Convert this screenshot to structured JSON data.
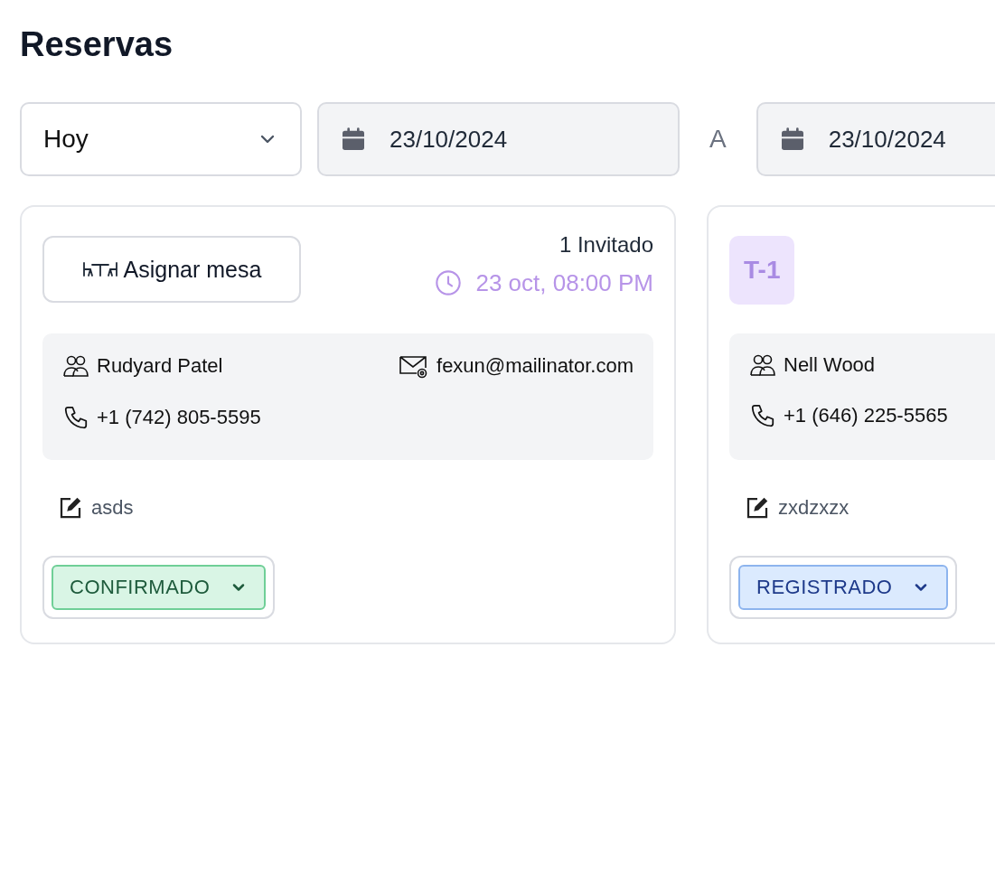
{
  "title": "Reservas",
  "filters": {
    "range": {
      "value": "Hoy"
    },
    "date_from": {
      "value": "23/10/2024"
    },
    "separator": "A",
    "date_to": {
      "value": "23/10/2024"
    }
  },
  "reservations": [
    {
      "header": {
        "kind": "assign",
        "button": "Asignar mesa",
        "guests": "1 Invitado",
        "time": "23 oct, 08:00 PM"
      },
      "name": "Rudyard Patel",
      "email": "fexun@mailinator.com",
      "phone": "+1 (742) 805-5595",
      "note": "asds",
      "status": {
        "kind": "confirmed",
        "label": "CONFIRMADO"
      }
    },
    {
      "header": {
        "kind": "table",
        "table": "T-1"
      },
      "name": "Nell Wood",
      "phone": "+1 (646) 225-5565",
      "note": "zxdzxzx",
      "status": {
        "kind": "registered",
        "label": "REGISTRADO"
      }
    }
  ]
}
